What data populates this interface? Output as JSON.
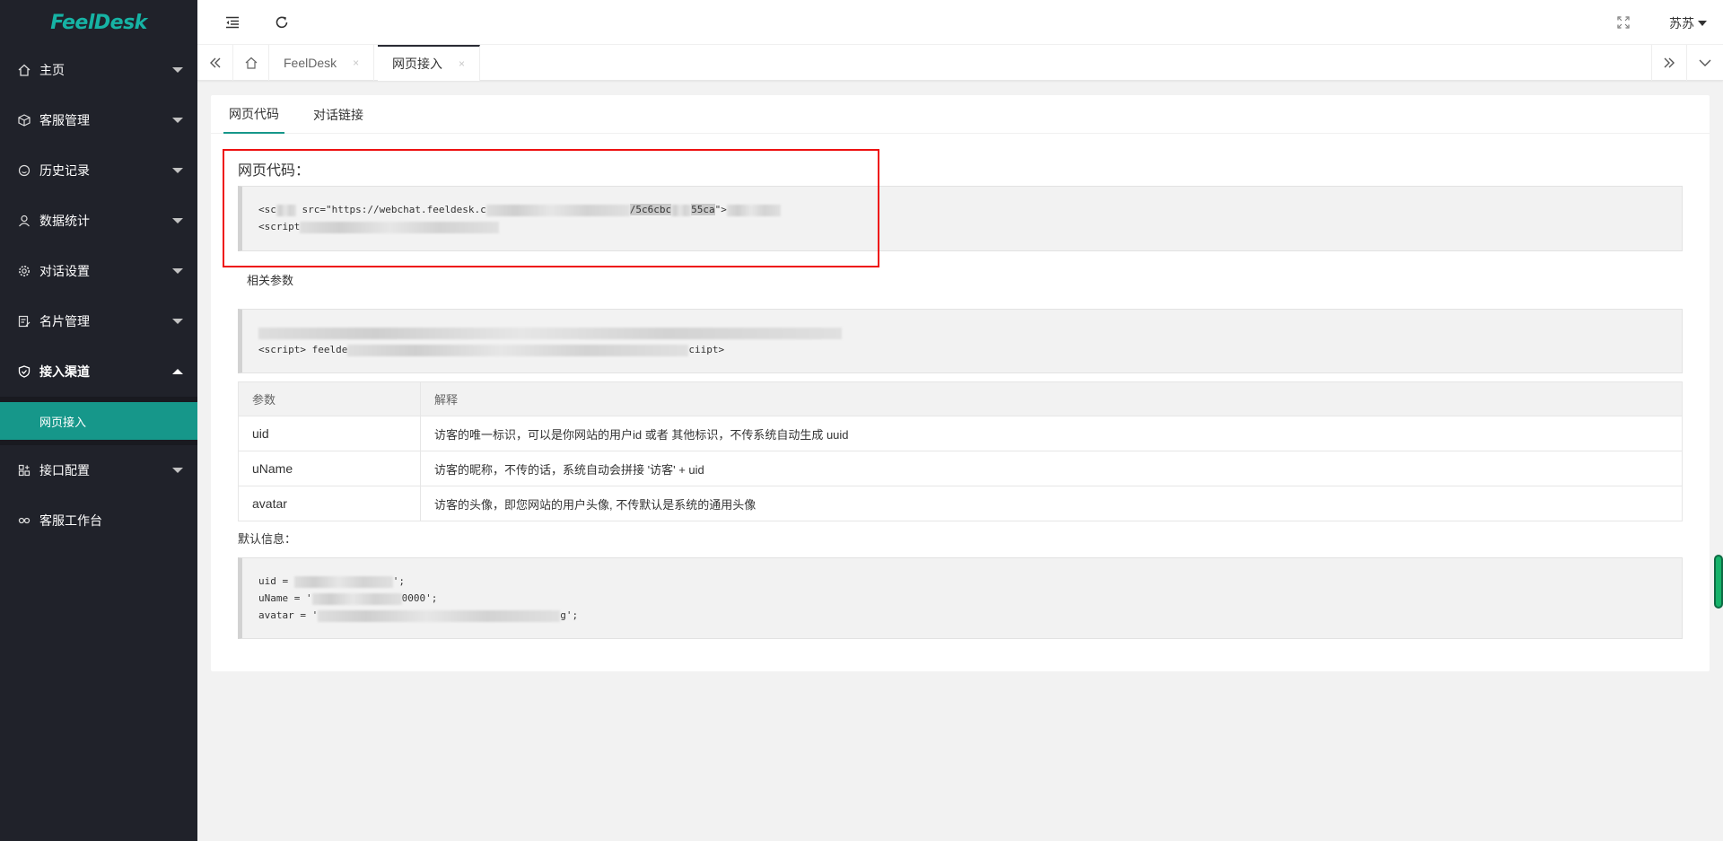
{
  "app": {
    "logo_text": "FeelDesk"
  },
  "sidebar": {
    "items": [
      {
        "label": "主页",
        "icon": "home-icon"
      },
      {
        "label": "客服管理",
        "icon": "cube-icon"
      },
      {
        "label": "历史记录",
        "icon": "circle-icon"
      },
      {
        "label": "数据统计",
        "icon": "user-icon"
      },
      {
        "label": "对话设置",
        "icon": "gear-icon"
      },
      {
        "label": "名片管理",
        "icon": "card-icon"
      },
      {
        "label": "接入渠道",
        "icon": "shield-icon"
      },
      {
        "label": "接口配置",
        "icon": "grid-icon"
      },
      {
        "label": "客服工作台",
        "icon": "link-icon"
      }
    ],
    "sub_item": {
      "label": "网页接入"
    }
  },
  "header": {
    "user": "苏苏"
  },
  "tabs": [
    {
      "label": "FeelDesk",
      "close": "×"
    },
    {
      "label": "网页接入",
      "close": "×"
    }
  ],
  "subtabs": [
    "网页代码",
    "对话链接"
  ],
  "code_section": {
    "title": "网页代码：",
    "line1_a": "<sc",
    "line1_b": " src=\"https://webchat.feeldesk.c",
    "line1_c": "/5c6cbc",
    "line1_d": "55ca",
    "line1_e": "\">",
    "line2_a": "<script"
  },
  "params": {
    "label": "相关参数",
    "line2_a": "<script> feelde",
    "line2_b": "ciipt>"
  },
  "table": {
    "headers": [
      "参数",
      "解释"
    ],
    "rows": [
      {
        "key": "uid",
        "desc": "访客的唯一标识，可以是你网站的用户id 或者 其他标识，不传系统自动生成 uuid"
      },
      {
        "key": "uName",
        "desc": "访客的昵称，不传的话，系统自动会拼接 '访客' + uid"
      },
      {
        "key": "avatar",
        "desc": "访客的头像，即您网站的用户头像, 不传默认是系统的通用头像"
      }
    ]
  },
  "defaults": {
    "label": "默认信息：",
    "line1_a": "uid = ",
    "line1_b": "';",
    "line2_a": "uName = '",
    "line2_b": "0000';",
    "line3_a": "avatar = '",
    "line3_b": "g';"
  }
}
